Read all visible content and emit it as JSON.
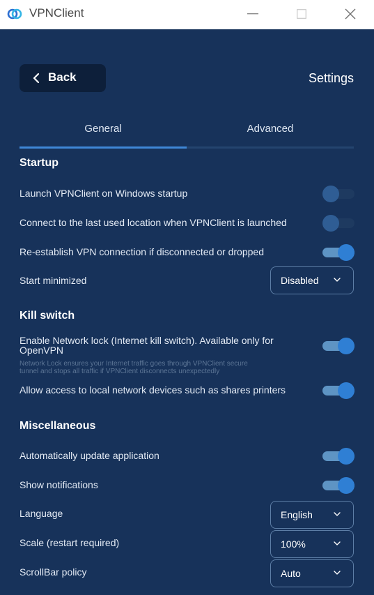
{
  "window": {
    "title": "VPNClient"
  },
  "header": {
    "back_label": "Back",
    "page_title": "Settings"
  },
  "tabs": [
    {
      "label": "General",
      "active": true
    },
    {
      "label": "Advanced",
      "active": false
    }
  ],
  "sections": {
    "startup": {
      "title": "Startup",
      "launch_on_startup": {
        "label": "Launch VPNClient on Windows startup",
        "on": false
      },
      "connect_last_location": {
        "label": "Connect to the last used location when VPNClient is launched",
        "on": false
      },
      "reestablish_connection": {
        "label": "Re-establish VPN connection if disconnected or dropped",
        "on": true
      },
      "start_minimized": {
        "label": "Start minimized",
        "value": "Disabled"
      }
    },
    "kill_switch": {
      "title": "Kill switch",
      "network_lock": {
        "label_line1": "Enable Network lock (Internet kill switch). Available only for",
        "label_line2": "OpenVPN",
        "desc_line1": "Network Lock ensures your Internet traffic goes through VPNClient secure",
        "desc_line2": "tunnel and stops all traffic if VPNClient disconnects unexpectedly",
        "on": true
      },
      "local_network_access": {
        "label": "Allow access to local network devices such as shares printers",
        "on": true
      }
    },
    "misc": {
      "title": "Miscellaneous",
      "auto_update": {
        "label": "Automatically update application",
        "on": true
      },
      "notifications": {
        "label": "Show notifications",
        "on": true
      },
      "language": {
        "label": "Language",
        "value": "English"
      },
      "scale": {
        "label": "Scale (restart required)",
        "value": "100%"
      },
      "scrollbar_policy": {
        "label": "ScrollBar policy",
        "value": "Auto"
      }
    }
  },
  "colors": {
    "panel_background": "#17325a",
    "accent": "#3f87d6",
    "toggle_on_knob": "#2f7fd4"
  },
  "icons": [
    "vpn-logo-icon",
    "minimize-icon",
    "maximize-icon",
    "close-icon",
    "chevron-left-icon",
    "chevron-down-icon"
  ]
}
